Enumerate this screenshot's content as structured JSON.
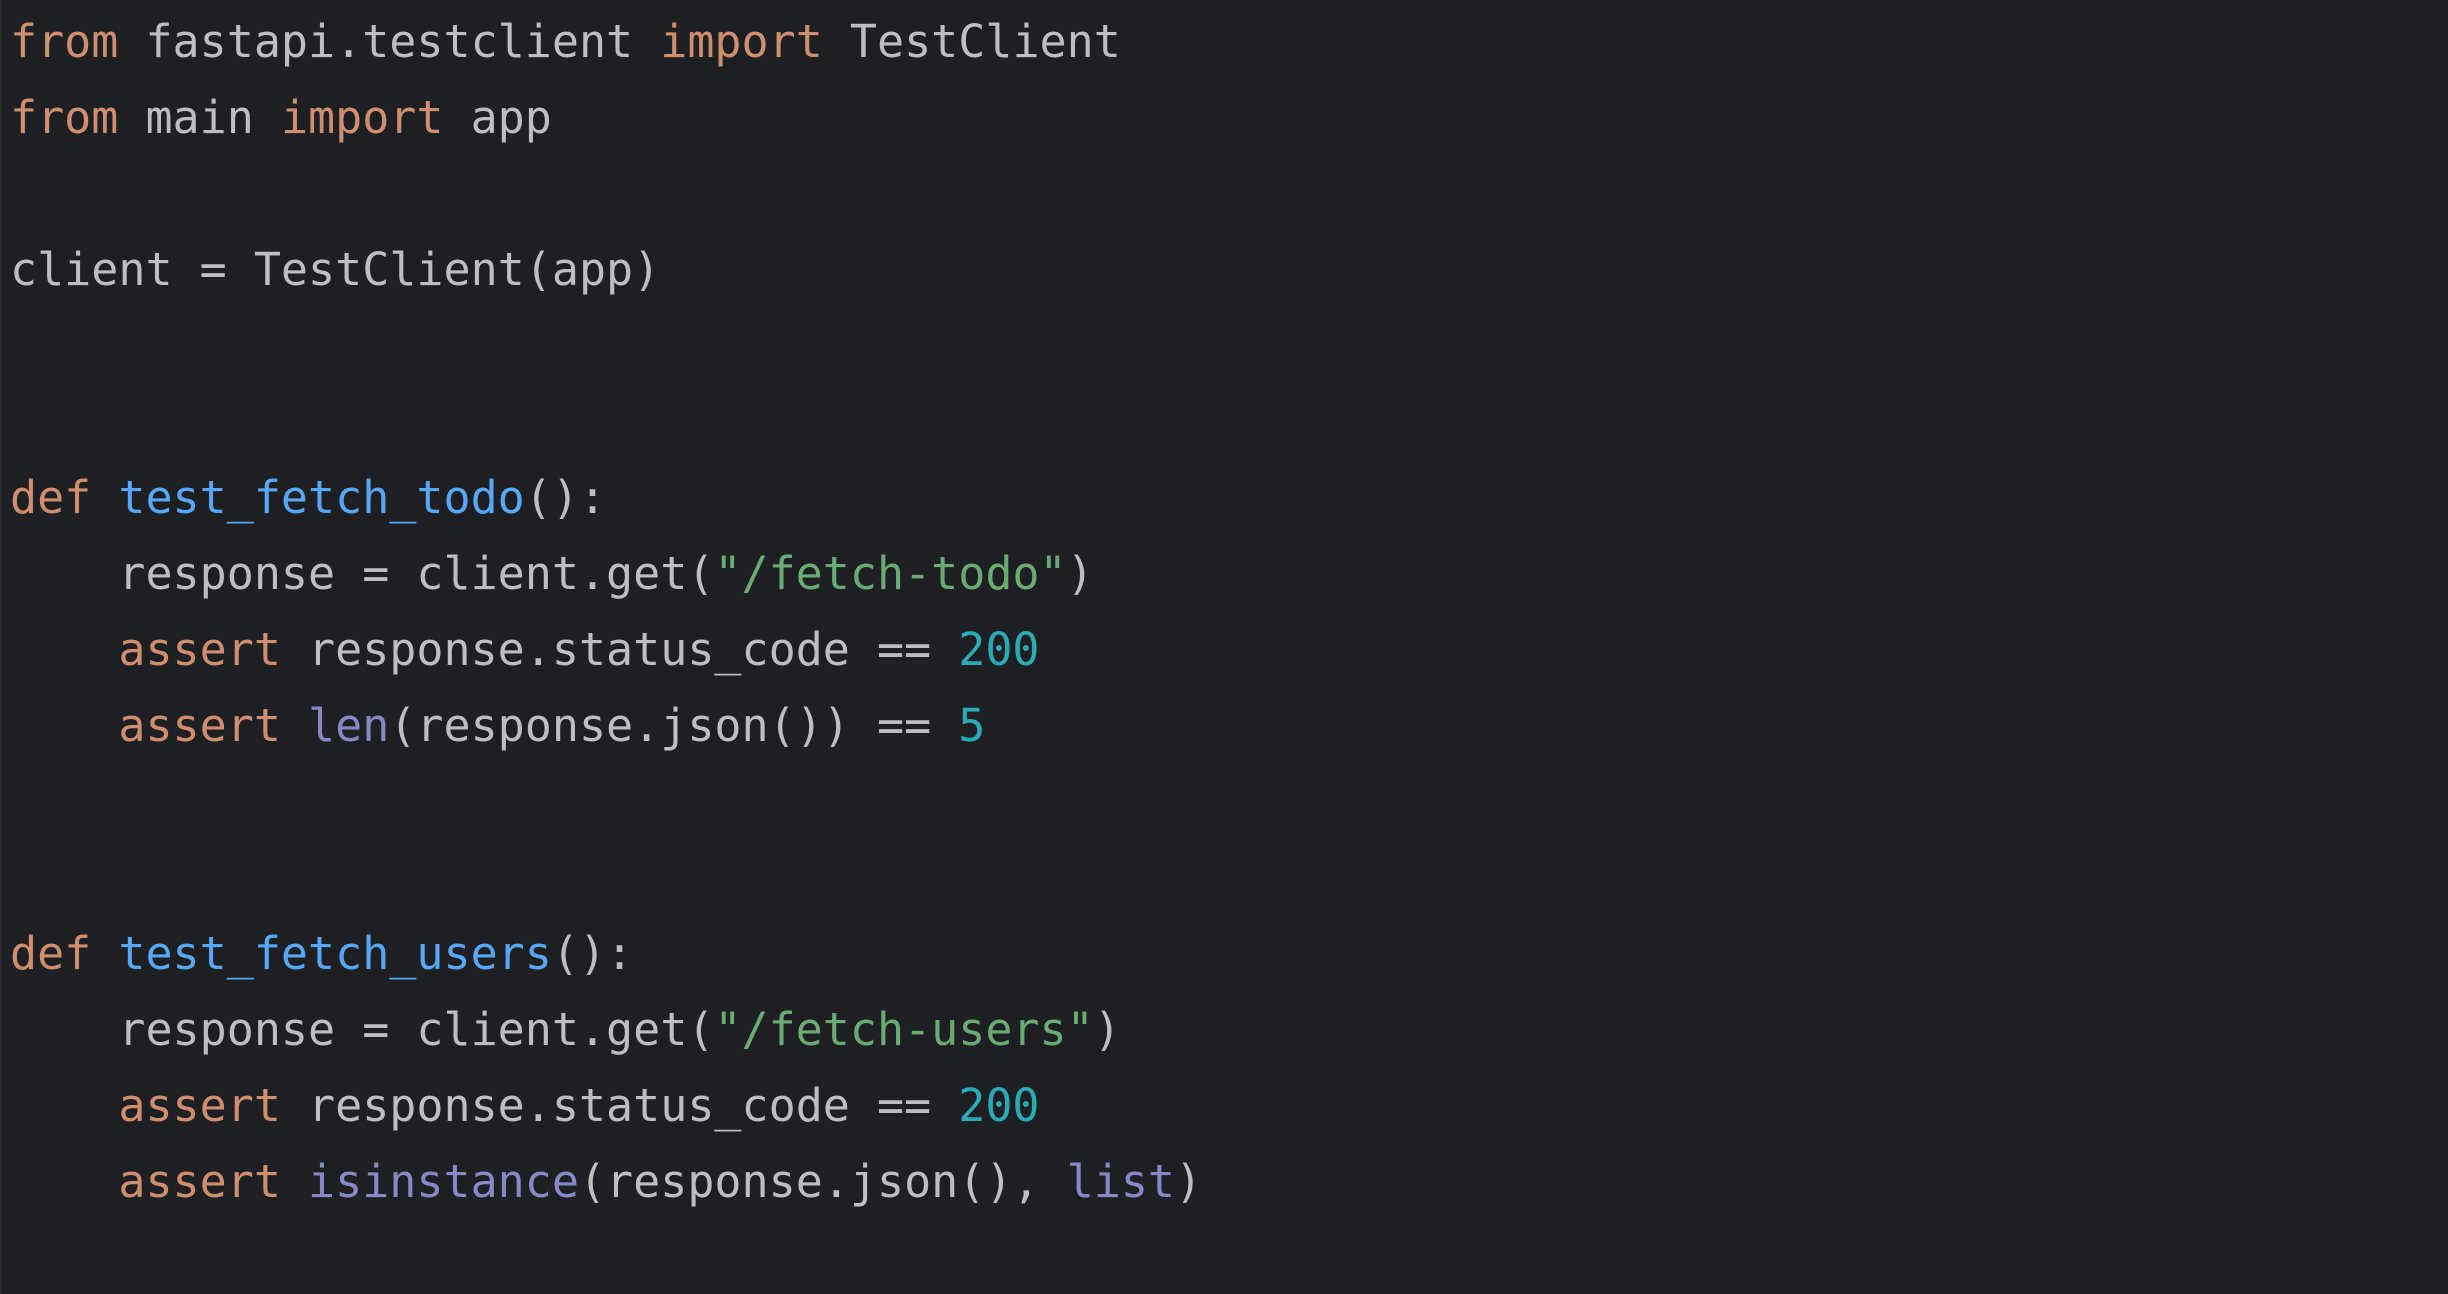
{
  "colors": {
    "background": "#1e1f22",
    "keyword": "#cf8e6d",
    "function_name": "#56a8f5",
    "string": "#6aab73",
    "number": "#2aacb8",
    "builtin": "#8888c6",
    "text": "#bcbec4"
  },
  "lines": [
    [
      {
        "type": "kw",
        "text": "from"
      },
      {
        "type": "plain",
        "text": " fastapi.testclient "
      },
      {
        "type": "kw",
        "text": "import"
      },
      {
        "type": "plain",
        "text": " TestClient"
      }
    ],
    [
      {
        "type": "kw",
        "text": "from"
      },
      {
        "type": "plain",
        "text": " main "
      },
      {
        "type": "kw",
        "text": "import"
      },
      {
        "type": "plain",
        "text": " app"
      }
    ],
    [],
    [
      {
        "type": "plain",
        "text": "client = TestClient(app)"
      }
    ],
    [],
    [],
    [
      {
        "type": "kw",
        "text": "def"
      },
      {
        "type": "plain",
        "text": " "
      },
      {
        "type": "fn",
        "text": "test_fetch_todo"
      },
      {
        "type": "plain",
        "text": "():"
      }
    ],
    [
      {
        "type": "plain",
        "text": "    response = client.get("
      },
      {
        "type": "str",
        "text": "\"/fetch-todo\""
      },
      {
        "type": "plain",
        "text": ")"
      }
    ],
    [
      {
        "type": "plain",
        "text": "    "
      },
      {
        "type": "kw",
        "text": "assert"
      },
      {
        "type": "plain",
        "text": " response.status_code == "
      },
      {
        "type": "num",
        "text": "200"
      }
    ],
    [
      {
        "type": "plain",
        "text": "    "
      },
      {
        "type": "kw",
        "text": "assert"
      },
      {
        "type": "plain",
        "text": " "
      },
      {
        "type": "builtin",
        "text": "len"
      },
      {
        "type": "plain",
        "text": "(response.json()) == "
      },
      {
        "type": "num",
        "text": "5"
      }
    ],
    [],
    [],
    [
      {
        "type": "kw",
        "text": "def"
      },
      {
        "type": "plain",
        "text": " "
      },
      {
        "type": "fn",
        "text": "test_fetch_users"
      },
      {
        "type": "plain",
        "text": "():"
      }
    ],
    [
      {
        "type": "plain",
        "text": "    response = client.get("
      },
      {
        "type": "str",
        "text": "\"/fetch-users\""
      },
      {
        "type": "plain",
        "text": ")"
      }
    ],
    [
      {
        "type": "plain",
        "text": "    "
      },
      {
        "type": "kw",
        "text": "assert"
      },
      {
        "type": "plain",
        "text": " response.status_code == "
      },
      {
        "type": "num",
        "text": "200"
      }
    ],
    [
      {
        "type": "plain",
        "text": "    "
      },
      {
        "type": "kw",
        "text": "assert"
      },
      {
        "type": "plain",
        "text": " "
      },
      {
        "type": "builtin",
        "text": "isinstance"
      },
      {
        "type": "plain",
        "text": "(response.json(), "
      },
      {
        "type": "builtin",
        "text": "list"
      },
      {
        "type": "plain",
        "text": ")"
      }
    ]
  ]
}
